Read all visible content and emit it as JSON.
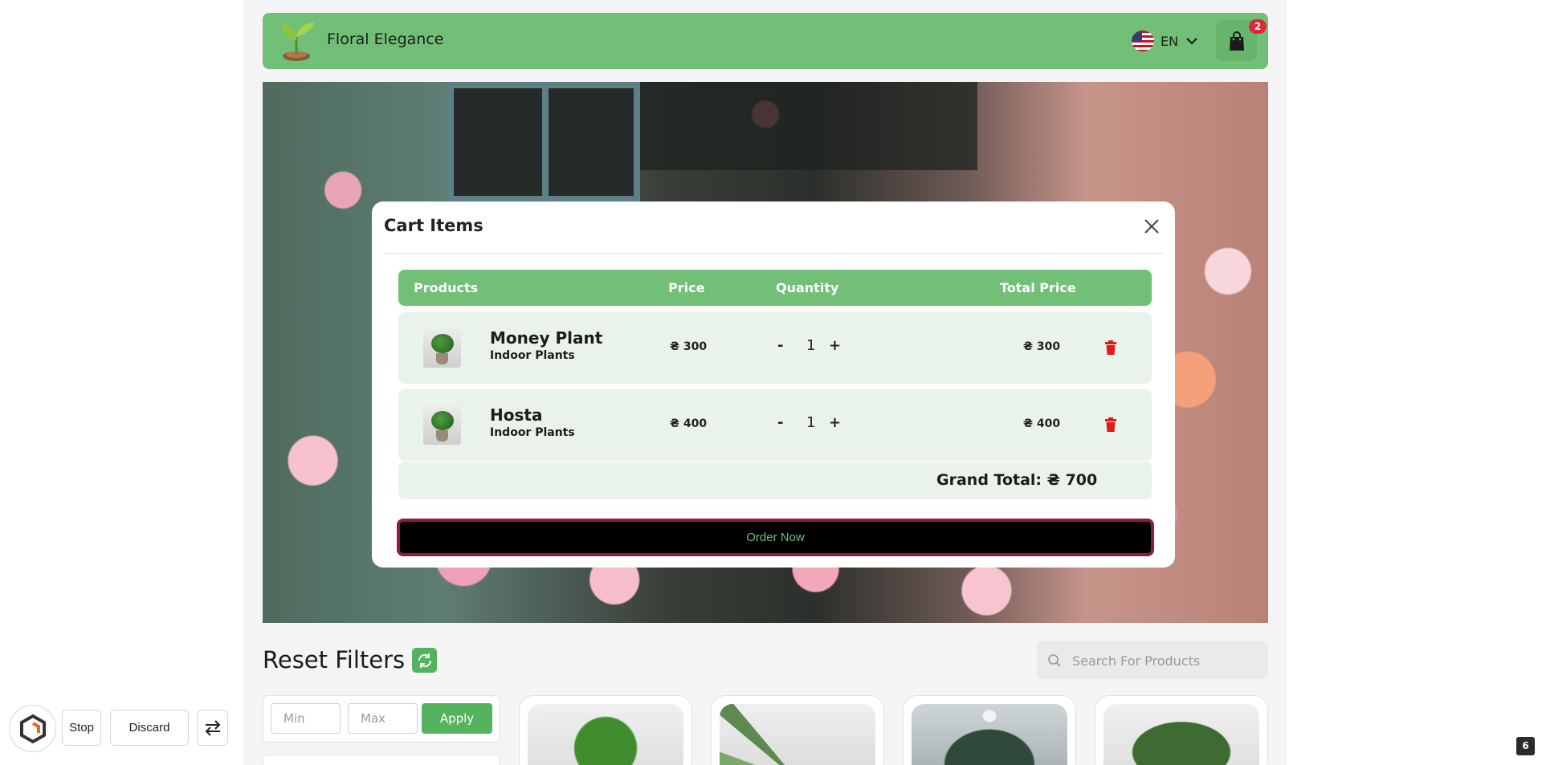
{
  "header": {
    "brand": "Floral Elegance",
    "language": "EN",
    "cart_count": "2",
    "accent_color": "#72bf78"
  },
  "modal": {
    "title": "Cart Items",
    "columns": [
      "Products",
      "Price",
      "Quantity",
      "Total Price"
    ],
    "items": [
      {
        "name": "Money Plant",
        "category": "Indoor Plants",
        "price": "₴ 300",
        "quantity": "1",
        "total": "₴ 300"
      },
      {
        "name": "Hosta",
        "category": "Indoor Plants",
        "price": "₴ 400",
        "quantity": "1",
        "total": "₴ 400"
      }
    ],
    "qty_minus": "-",
    "qty_plus": "+",
    "grand_total": "Grand Total: ₴ 700",
    "order_label": "Order Now"
  },
  "filters": {
    "title": "Reset Filters",
    "min_placeholder": "Min",
    "max_placeholder": "Max",
    "apply_label": "Apply",
    "search_placeholder": "Search For Products"
  },
  "toolbar": {
    "stop_label": "Stop",
    "discard_label": "Discard",
    "corner_badge": "6"
  },
  "icons": {
    "logo": "sprout-logo-icon",
    "flag": "us-flag-icon",
    "chevron": "chevron-down-icon",
    "cart": "shopping-bag-icon",
    "close": "close-icon",
    "delete": "trash-icon",
    "reset": "refresh-icon",
    "search": "search-icon",
    "swap": "swap-arrows-icon"
  },
  "colors": {
    "danger": "#e0263b",
    "row_bg": "#e9f3ea",
    "order_border": "#8b1e3f"
  }
}
